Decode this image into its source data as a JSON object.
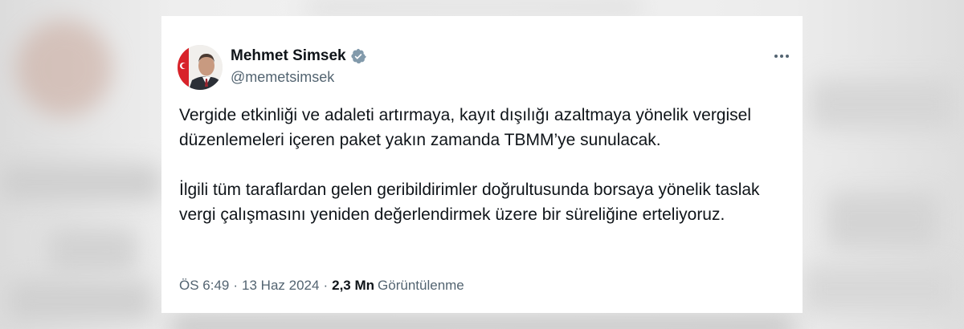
{
  "author": {
    "name": "Mehmet Simsek",
    "handle": "@memetsimsek",
    "verified": true,
    "verified_color": "#829aab"
  },
  "tweet": {
    "paragraphs": [
      "Vergide etkinliği ve adaleti artırmaya, kayıt dışılığı azaltmaya yönelik vergisel düzenlemeleri içeren paket yakın zamanda TBMM’ye sunulacak.",
      "İlgili tüm taraflardan gelen geribildirimler doğrultusunda borsaya yönelik taslak vergi çalışmasını yeniden değerlendirmek üzere bir süreliğine erteliyoruz."
    ]
  },
  "meta": {
    "time": "ÖS 6:49",
    "date": "13 Haz 2024",
    "separator": "·",
    "views_count": "2,3 Mn",
    "views_label": "Görüntülenme"
  },
  "icons": {
    "more": "more-options-icon",
    "verified": "verified-badge-icon"
  },
  "colors": {
    "text_primary": "#0f1419",
    "text_secondary": "#536471",
    "card_background": "#ffffff"
  }
}
